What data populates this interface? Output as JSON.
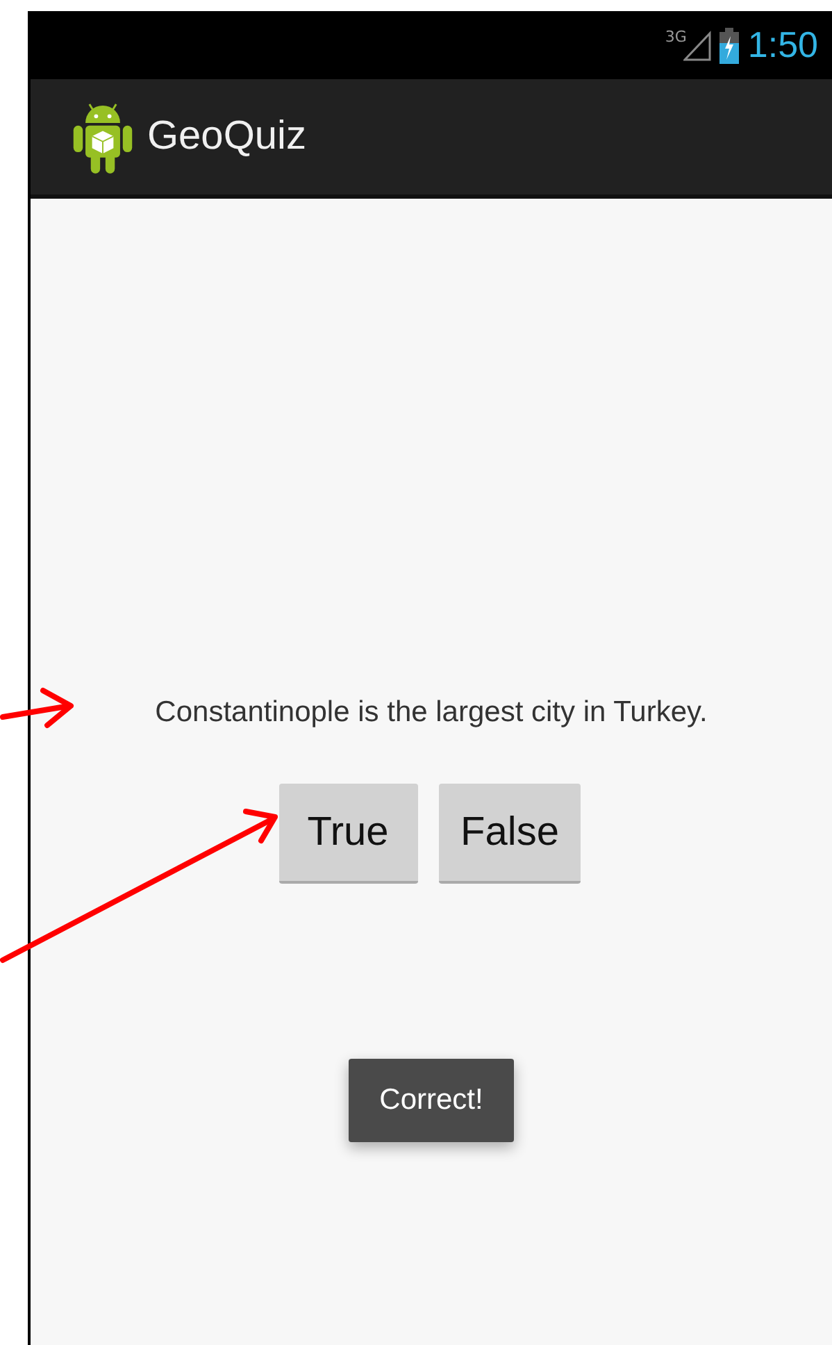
{
  "status_bar": {
    "network": "3G",
    "time": "1:50"
  },
  "action_bar": {
    "title": "GeoQuiz"
  },
  "question": "Constantinople is the largest city in Turkey.",
  "buttons": [
    "True",
    "False"
  ],
  "toast": "Correct!"
}
